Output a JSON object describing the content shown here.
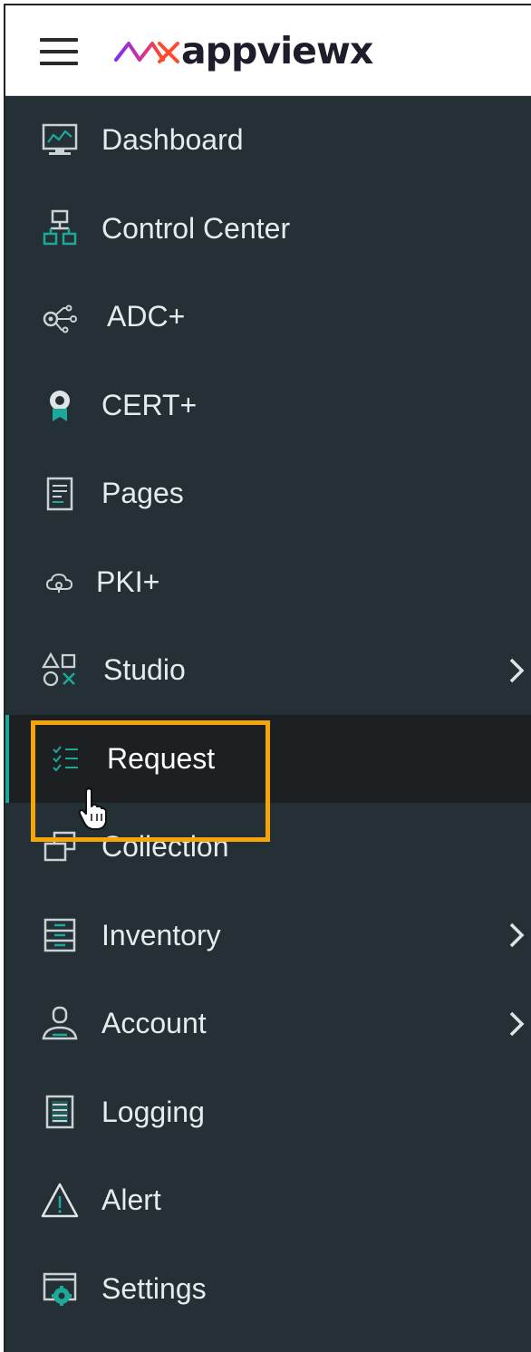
{
  "header": {
    "menu_icon": "hamburger-menu-icon",
    "logo_text": "appviewx",
    "logo_colors": {
      "wave_start": "#7b2ff7",
      "wave_end": "#ff4b2b",
      "text": "#1d1d2b"
    }
  },
  "sidebar": {
    "accent_color": "#1ea89a",
    "background": "#243035",
    "active_background": "#1c2022",
    "items": [
      {
        "label": "Dashboard",
        "icon": "monitor-chart-icon",
        "has_submenu": false,
        "active": false
      },
      {
        "label": "Control Center",
        "icon": "hierarchy-icon",
        "has_submenu": false,
        "active": false
      },
      {
        "label": "ADC+",
        "icon": "network-nodes-icon",
        "has_submenu": false,
        "active": false
      },
      {
        "label": "CERT+",
        "icon": "certificate-badge-icon",
        "has_submenu": false,
        "active": false
      },
      {
        "label": "Pages",
        "icon": "document-icon",
        "has_submenu": false,
        "active": false
      },
      {
        "label": "PKI+",
        "icon": "cloud-key-icon",
        "has_submenu": false,
        "active": false
      },
      {
        "label": "Studio",
        "icon": "shapes-icon",
        "has_submenu": true,
        "active": false
      },
      {
        "label": "Request",
        "icon": "checklist-icon",
        "has_submenu": false,
        "active": true
      },
      {
        "label": "Collection",
        "icon": "stacked-windows-icon",
        "has_submenu": false,
        "active": false
      },
      {
        "label": "Inventory",
        "icon": "drawer-cabinet-icon",
        "has_submenu": true,
        "active": false
      },
      {
        "label": "Account",
        "icon": "user-icon",
        "has_submenu": true,
        "active": false
      },
      {
        "label": "Logging",
        "icon": "log-file-icon",
        "has_submenu": false,
        "active": false
      },
      {
        "label": "Alert",
        "icon": "warning-triangle-icon",
        "has_submenu": false,
        "active": false
      },
      {
        "label": "Settings",
        "icon": "settings-window-icon",
        "has_submenu": false,
        "active": false
      }
    ]
  },
  "annotation": {
    "highlight_color": "#f5a40a",
    "target": "Request",
    "cursor": "hand-pointer-icon"
  }
}
